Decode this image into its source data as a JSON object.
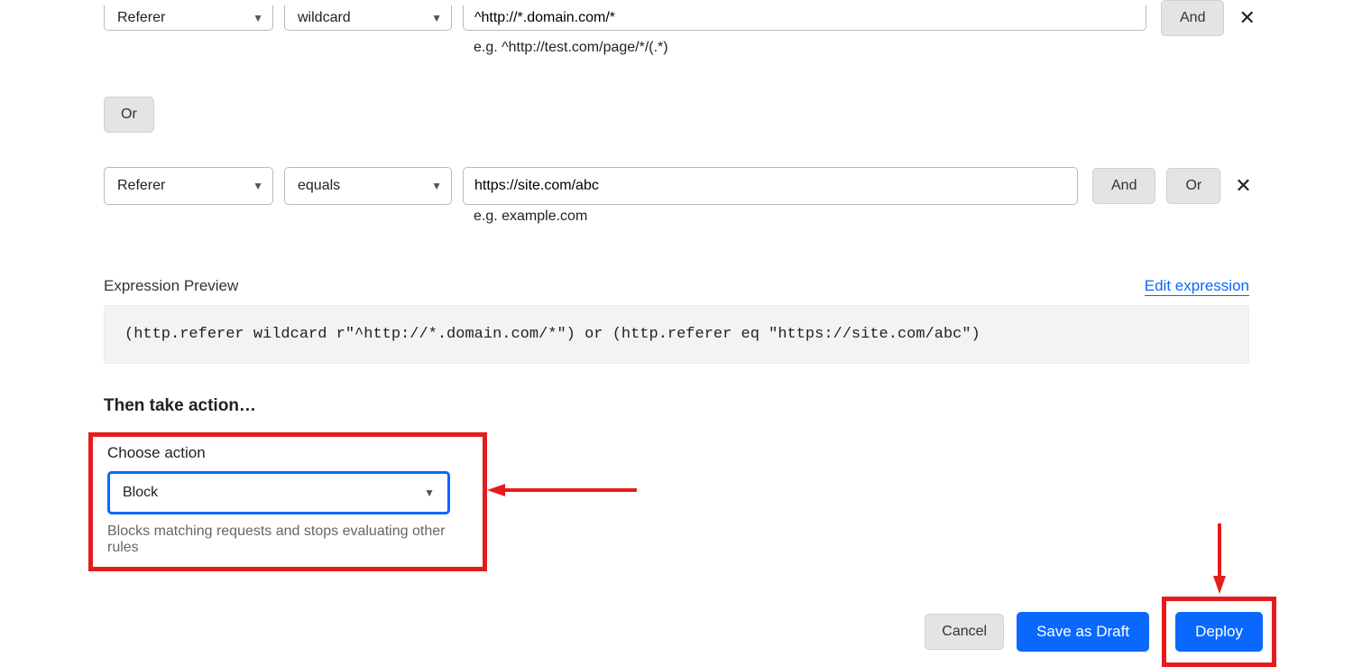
{
  "rule1": {
    "field": "Referer",
    "operator": "wildcard",
    "value": "^http://*.domain.com/*",
    "hint": "e.g. ^http://test.com/page/*/(.*)",
    "and_label": "And"
  },
  "or_label": "Or",
  "rule2": {
    "field": "Referer",
    "operator": "equals",
    "value": "https://site.com/abc",
    "hint": "e.g. example.com",
    "and_label": "And",
    "or_label": "Or"
  },
  "preview": {
    "label": "Expression Preview",
    "edit_label": "Edit expression",
    "code": "(http.referer wildcard r\"^http://*.domain.com/*\") or (http.referer eq \"https://site.com/abc\")"
  },
  "action": {
    "heading": "Then take action…",
    "choose_label": "Choose action",
    "value": "Block",
    "description": "Blocks matching requests and stops evaluating other rules"
  },
  "buttons": {
    "cancel": "Cancel",
    "draft": "Save as Draft",
    "deploy": "Deploy"
  },
  "colors": {
    "highlight": "#e41c1c",
    "blue": "#0a68ff"
  }
}
